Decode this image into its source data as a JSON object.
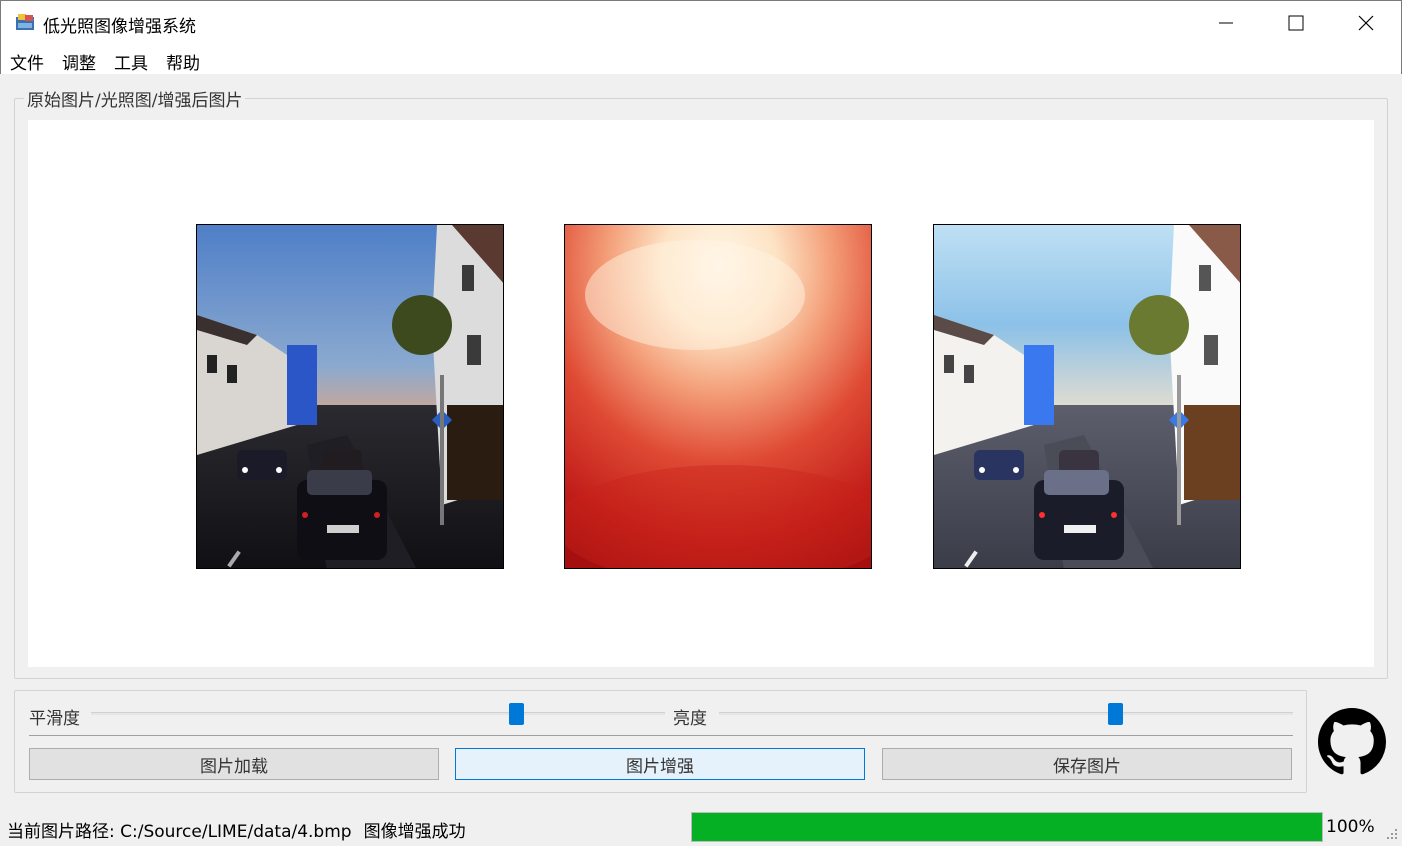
{
  "window": {
    "title": "低光照图像增强系统",
    "app_icon": "python-icon"
  },
  "menu": [
    "文件",
    "调整",
    "工具",
    "帮助"
  ],
  "image_group": {
    "title": "原始图片/光照图/增强后图片"
  },
  "controls": {
    "smooth_label": "平滑度",
    "smooth_value": 0.74,
    "brightness_label": "亮度",
    "brightness_value": 0.69,
    "buttons": {
      "load": "图片加载",
      "enhance": "图片增强",
      "save": "保存图片"
    }
  },
  "status": {
    "path_text": "当前图片路径: C:/Source/LIME/data/4.bmp",
    "message": "图像增强成功",
    "progress_percent": 100,
    "progress_text": "100%"
  },
  "colors": {
    "accent": "#0078d7",
    "progress": "#06b025"
  }
}
